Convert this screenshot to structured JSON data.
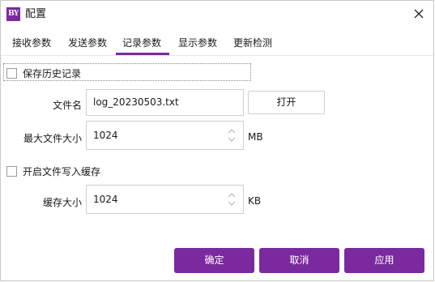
{
  "window": {
    "title": "配置",
    "icon_text": "BY",
    "accent": "#7a2a9e"
  },
  "tabs": [
    {
      "label": "接收参数",
      "active": false
    },
    {
      "label": "发送参数",
      "active": false
    },
    {
      "label": "记录参数",
      "active": true
    },
    {
      "label": "显示参数",
      "active": false
    },
    {
      "label": "更新检测",
      "active": false
    }
  ],
  "save_history": {
    "label": "保存历史记录",
    "checked": false
  },
  "filename": {
    "label": "文件名",
    "value": "log_20230503.txt",
    "open_button": "打开"
  },
  "max_size": {
    "label": "最大文件大小",
    "value": "1024",
    "unit": "MB"
  },
  "cache_write": {
    "label": "开启文件写入缓存",
    "checked": false
  },
  "cache_size": {
    "label": "缓存大小",
    "value": "1024",
    "unit": "KB"
  },
  "buttons": {
    "ok": "确定",
    "cancel": "取消",
    "apply": "应用"
  },
  "icons": {
    "close": "close-icon",
    "app": "app-icon",
    "spin": "spin-arrows-icon"
  }
}
